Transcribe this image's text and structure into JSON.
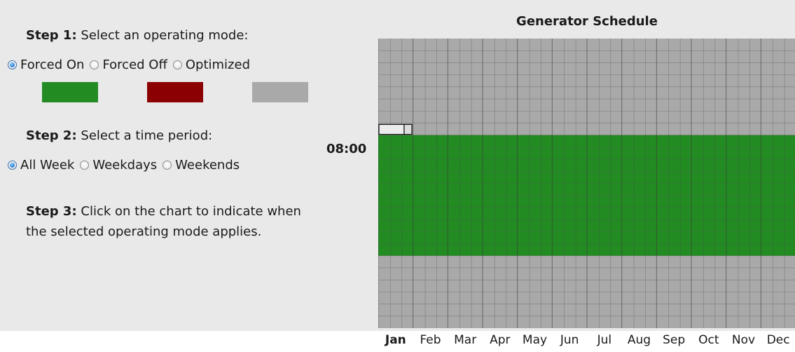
{
  "step1": {
    "label": "Step 1:",
    "text": "Select an operating mode:"
  },
  "modes": [
    {
      "label": "Forced On",
      "checked": true,
      "color": "#228b22"
    },
    {
      "label": "Forced Off",
      "checked": false,
      "color": "#8b0000"
    },
    {
      "label": "Optimized",
      "checked": false,
      "color": "#a9a9a9"
    }
  ],
  "step2": {
    "label": "Step 2:",
    "text": "Select a time period:"
  },
  "periods": [
    {
      "label": "All Week",
      "checked": true
    },
    {
      "label": "Weekdays",
      "checked": false
    },
    {
      "label": "Weekends",
      "checked": false
    }
  ],
  "step3": {
    "label": "Step 3:",
    "text": "Click on the chart to indicate when the selected operating mode applies."
  },
  "chart": {
    "title": "Generator Schedule",
    "hover_time": "08:00",
    "months": [
      "Jan",
      "Feb",
      "Mar",
      "Apr",
      "May",
      "Jun",
      "Jul",
      "Aug",
      "Sep",
      "Oct",
      "Nov",
      "Dec"
    ],
    "highlighted_month": "Jan",
    "forced_on_start_hour": 8,
    "forced_on_end_hour": 18,
    "hours_per_day": 24,
    "colors": {
      "forced_on": "#228b22",
      "optimized": "#a9a9a9",
      "grid_line": "#5a5a5a"
    }
  }
}
